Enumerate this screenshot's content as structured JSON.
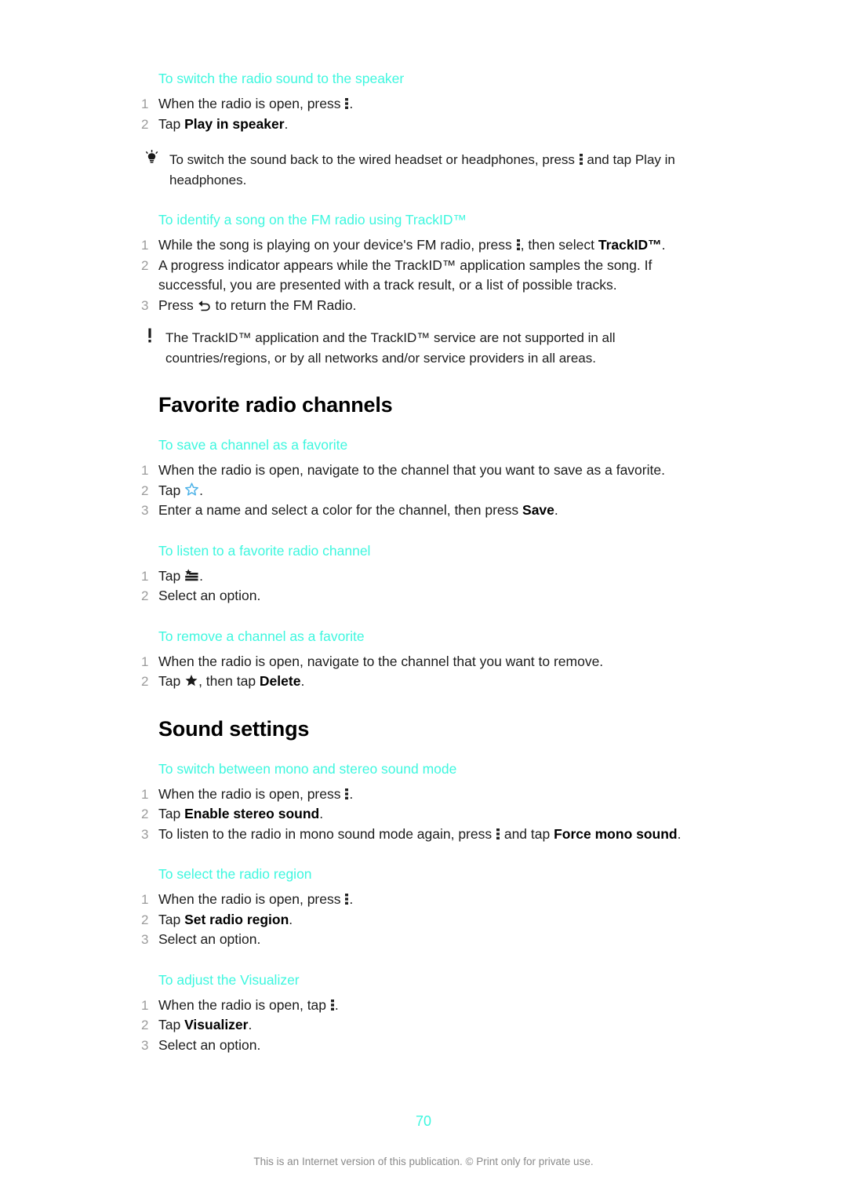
{
  "document": {
    "page_number": "70",
    "footer_note": "This is an Internet version of this publication. © Print only for private use.",
    "accent_color": "#3ef7df",
    "text_color": "#1c1c1c",
    "number_color": "#9b9b9b"
  },
  "blocks": {
    "speaker_task": {
      "title": "To switch the radio sound to the speaker",
      "steps": [
        {
          "num": "1",
          "pre": "When the radio is open, press ",
          "icon": "overflow-menu-icon",
          "post": "."
        },
        {
          "num": "2",
          "pre": "Tap ",
          "bold": "Play in speaker",
          "post": "."
        }
      ],
      "tip": {
        "icon": "lightbulb-icon",
        "pre": "To switch the sound back to the wired headset or headphones, press ",
        "inline_icon": "overflow-menu-icon",
        "post": " and tap Play in headphones."
      }
    },
    "trackid_task": {
      "title": "To identify a song on the FM radio using TrackID™",
      "steps": [
        {
          "num": "1",
          "pre": "While the song is playing on your device's FM radio, press ",
          "icon": "overflow-menu-icon",
          "mid": ", then select ",
          "bold": "TrackID™",
          "post": "."
        },
        {
          "num": "2",
          "pre": "A progress indicator appears while the TrackID™ application samples the song. If successful, you are presented with a track result, or a list of possible tracks."
        },
        {
          "num": "3",
          "pre": "Press ",
          "icon": "back-arrow-icon",
          "post": " to return the FM Radio."
        }
      ],
      "note": {
        "icon": "exclamation-icon",
        "text": "The TrackID™ application and the TrackID™ service are not supported in all countries/regions, or by all networks and/or service providers in all areas."
      }
    },
    "favorite_channels": {
      "heading": "Favorite radio channels",
      "save_task": {
        "title": "To save a channel as a favorite",
        "steps": [
          {
            "num": "1",
            "pre": "When the radio is open, navigate to the channel that you want to save as a favorite."
          },
          {
            "num": "2",
            "pre": "Tap ",
            "icon": "star-outline-icon",
            "post": "."
          },
          {
            "num": "3",
            "pre": "Enter a name and select a color for the channel, then press ",
            "bold": "Save",
            "post": "."
          }
        ]
      },
      "listen_task": {
        "title": "To listen to a favorite radio channel",
        "steps": [
          {
            "num": "1",
            "pre": "Tap ",
            "icon": "favorites-list-icon",
            "post": "."
          },
          {
            "num": "2",
            "pre": "Select an option."
          }
        ]
      },
      "remove_task": {
        "title": "To remove a channel as a favorite",
        "steps": [
          {
            "num": "1",
            "pre": "When the radio is open, navigate to the channel that you want to remove."
          },
          {
            "num": "2",
            "pre": "Tap ",
            "icon": "star-filled-icon",
            "mid": ", then tap ",
            "bold": "Delete",
            "post": "."
          }
        ]
      }
    },
    "sound_settings": {
      "heading": "Sound settings",
      "mono_stereo_task": {
        "title": "To switch between mono and stereo sound mode",
        "steps": [
          {
            "num": "1",
            "pre": "When the radio is open, press ",
            "icon": "overflow-menu-icon",
            "post": "."
          },
          {
            "num": "2",
            "pre": "Tap ",
            "bold": "Enable stereo sound",
            "post": "."
          },
          {
            "num": "3",
            "pre": "To listen to the radio in mono sound mode again, press ",
            "icon": "overflow-menu-icon",
            "mid": " and tap ",
            "bold": "Force mono sound",
            "post": "."
          }
        ]
      },
      "region_task": {
        "title": "To select the radio region",
        "steps": [
          {
            "num": "1",
            "pre": "When the radio is open, press ",
            "icon": "overflow-menu-icon",
            "post": "."
          },
          {
            "num": "2",
            "pre": "Tap ",
            "bold": "Set radio region",
            "post": "."
          },
          {
            "num": "3",
            "pre": "Select an option."
          }
        ]
      },
      "visualizer_task": {
        "title": "To adjust the Visualizer",
        "steps": [
          {
            "num": "1",
            "pre": "When the radio is open, tap ",
            "icon": "overflow-menu-icon",
            "post": "."
          },
          {
            "num": "2",
            "pre": "Tap ",
            "bold": "Visualizer",
            "post": "."
          },
          {
            "num": "3",
            "pre": "Select an option."
          }
        ]
      }
    }
  }
}
